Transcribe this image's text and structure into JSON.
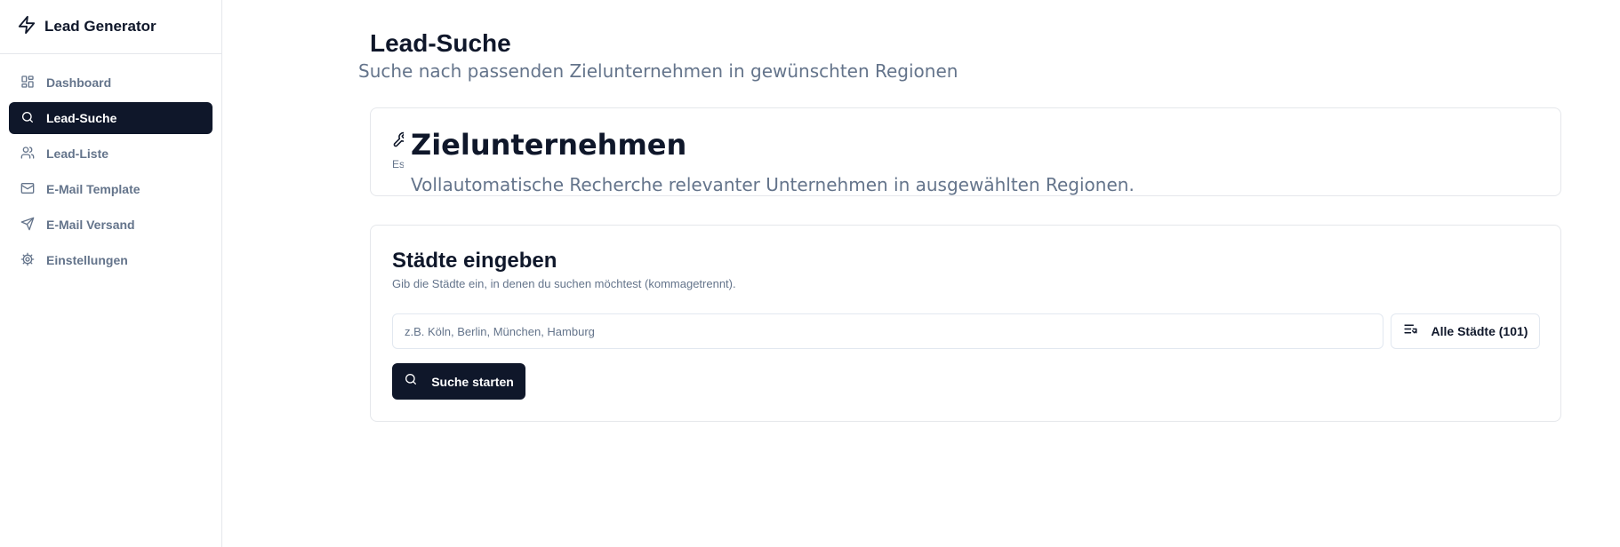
{
  "app": {
    "name": "Lead Generator",
    "brand_icon": "zap-icon"
  },
  "sidebar": {
    "items": [
      {
        "label": "Dashboard",
        "icon": "dashboard-icon",
        "active": false
      },
      {
        "label": "Lead-Suche",
        "icon": "search-icon",
        "active": true
      },
      {
        "label": "Lead-Liste",
        "icon": "users-icon",
        "active": false
      },
      {
        "label": "E-Mail Template",
        "icon": "mail-icon",
        "active": false
      },
      {
        "label": "E-Mail Versand",
        "icon": "send-icon",
        "active": false
      },
      {
        "label": "Einstellungen",
        "icon": "gear-icon",
        "active": false
      }
    ]
  },
  "page": {
    "title": "Lead-Suche",
    "subtitle": "Suche nach passenden Zielunternehmen in gewünschten Regionen"
  },
  "target_card": {
    "icon": "wrench-icon",
    "clipped_text": "Es v",
    "title": "Zielunternehmen",
    "description": "Vollautomatische Recherche relevanter Unternehmen in ausgewählten Regionen."
  },
  "cities_card": {
    "title": "Städte eingeben",
    "description": "Gib die Städte ein, in denen du suchen möchtest (kommagetrennt).",
    "input": {
      "value": "",
      "placeholder": "z.B. Köln, Berlin, München, Hamburg"
    },
    "all_cities_button": {
      "label": "Alle Städte (101)",
      "icon": "list-end-icon"
    },
    "search_button": {
      "label": "Suche starten",
      "icon": "search-icon"
    }
  },
  "colors": {
    "primary": "#0f172a",
    "muted_text": "#64748b",
    "border": "#e5e7eb",
    "background": "#ffffff"
  }
}
